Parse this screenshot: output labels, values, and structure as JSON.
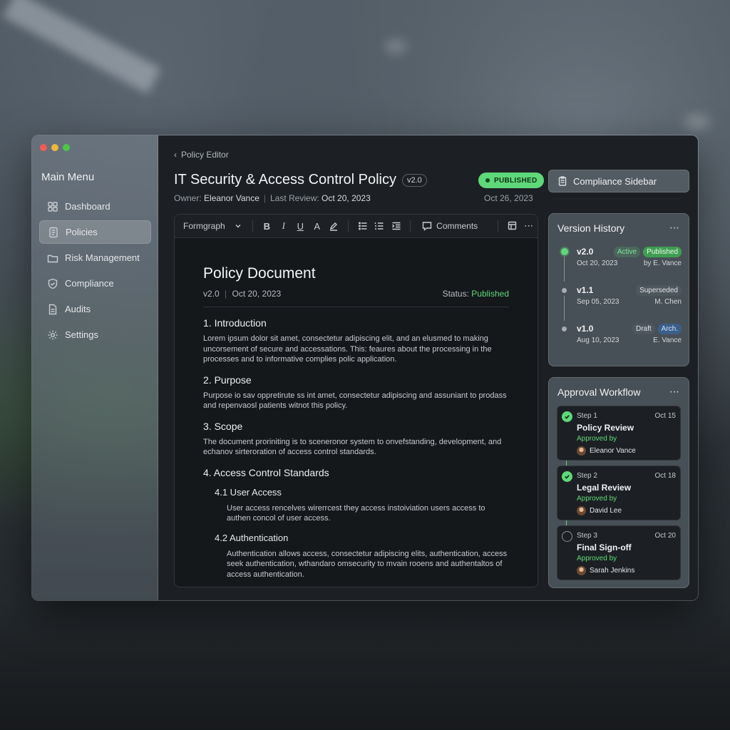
{
  "window": {
    "traffic_lights": {
      "close": "#ee5d55",
      "minimize": "#f0b63c",
      "zoom": "#4fc447"
    }
  },
  "sidebar": {
    "title": "Main Menu",
    "items": [
      {
        "label": "Dashboard",
        "icon": "grid-icon",
        "active": false
      },
      {
        "label": "Policies",
        "icon": "document-icon",
        "active": true
      },
      {
        "label": "Risk Management",
        "icon": "folder-icon",
        "active": false
      },
      {
        "label": "Compliance",
        "icon": "shield-check-icon",
        "active": false
      },
      {
        "label": "Audits",
        "icon": "file-icon",
        "active": false
      },
      {
        "label": "Settings",
        "icon": "gear-icon",
        "active": false
      }
    ]
  },
  "header": {
    "breadcrumb": "Policy Editor",
    "title": "IT Security & Access Control Policy",
    "version": "v2.0",
    "status_badge": "PUBLISHED",
    "owner_label": "Owner:",
    "owner": "Eleanor Vance",
    "review_label": "Last Review:",
    "review_date": "Oct 20, 2023",
    "date": "Oct 26, 2023"
  },
  "toolbar": {
    "format_label": "Formgraph",
    "comments_label": "Comments"
  },
  "document": {
    "heading": "Policy Document",
    "version": "v2.0",
    "date": "Oct 20, 2023",
    "status_label": "Status:",
    "status": "Published",
    "sections": {
      "intro_h": "1. Introduction",
      "intro_p": "Lorem ipsum dolor sit amet, consectetur adipiscing elit, and an elusmed to making uncorsement of secure and accessations. This: feaures about the processing in the processes and to informative complies polic application.",
      "purpose_h": "2. Purpose",
      "purpose_p": "Purpose io sav oppretirute ss int amet, consectetur adipiscing and assuniant to prodass and repenvaosl patients witnot this policy.",
      "scope_h": "3. Scope",
      "scope_p": "The document proriniting is to sceneronor system to onvefstanding, development, and echanov sirteroration of access control standards.",
      "acs_h": "4. Access Control Standards",
      "ua_h": "4.1 User Access",
      "ua_p": "User access rencelves wirerrcest they access instoiviation users access to authen concol of user access.",
      "auth_h": "4.2 Authentication",
      "auth_p": "Authentication allows access, consectetur adipiscing elits, authentication, access seek authentication, wthandaro omsecurity to mvain rooens and authentaltos of access authentication."
    }
  },
  "compliance_sidebar": {
    "label": "Compliance Sidebar"
  },
  "version_history": {
    "title": "Version History",
    "items": [
      {
        "version": "v2.0",
        "date": "Oct 20, 2023",
        "by": "by E. Vance",
        "tags": [
          "Active",
          "Published"
        ]
      },
      {
        "version": "v1.1",
        "date": "Sep 05, 2023",
        "by": "M. Chen",
        "tags": [
          "Superseded"
        ]
      },
      {
        "version": "v1.0",
        "date": "Aug 10, 2023",
        "by": "E. Vance",
        "tags": [
          "Draft",
          "Arch."
        ]
      }
    ]
  },
  "approval_workflow": {
    "title": "Approval Workflow",
    "steps": [
      {
        "step": "Step 1",
        "date": "Oct 15",
        "name": "Policy Review",
        "approved_label": "Approved by",
        "person": "Eleanor Vance",
        "done": true
      },
      {
        "step": "Step 2",
        "date": "Oct 18",
        "name": "Legal Review",
        "approved_label": "Approved by",
        "person": "David Lee",
        "done": true
      },
      {
        "step": "Step 3",
        "date": "Oct 20",
        "name": "Final Sign-off",
        "approved_label": "Approved by",
        "person": "Sarah Jenkins",
        "done": false
      }
    ]
  },
  "colors": {
    "accent_green": "#5fd87a",
    "archived_blue": "#3b5f8a"
  }
}
